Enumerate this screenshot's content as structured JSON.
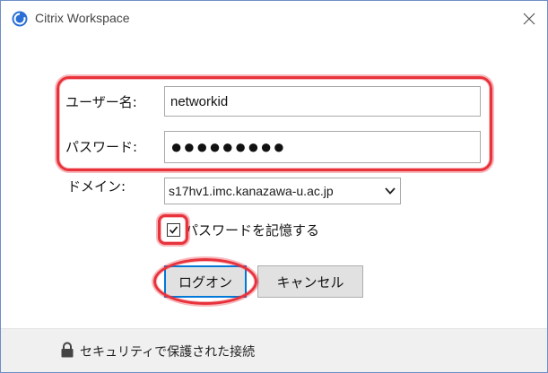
{
  "window": {
    "title": "Citrix Workspace"
  },
  "form": {
    "username_label": "ユーザー名:",
    "username_value": "networkid",
    "password_label": "パスワード:",
    "password_value": "●●●●●●●●●",
    "domain_label": "ドメイン:",
    "domain_value": "s17hv1.imc.kanazawa-u.ac.jp",
    "remember_label": "パスワードを記憶する",
    "remember_checked": true
  },
  "buttons": {
    "logon": "ログオン",
    "cancel": "キャンセル"
  },
  "footer": {
    "secure_text": "セキュリティで保護された接続"
  },
  "colors": {
    "annotation": "#e8323c",
    "accent": "#0078d7",
    "icon_blue": "#2a6fd6"
  }
}
